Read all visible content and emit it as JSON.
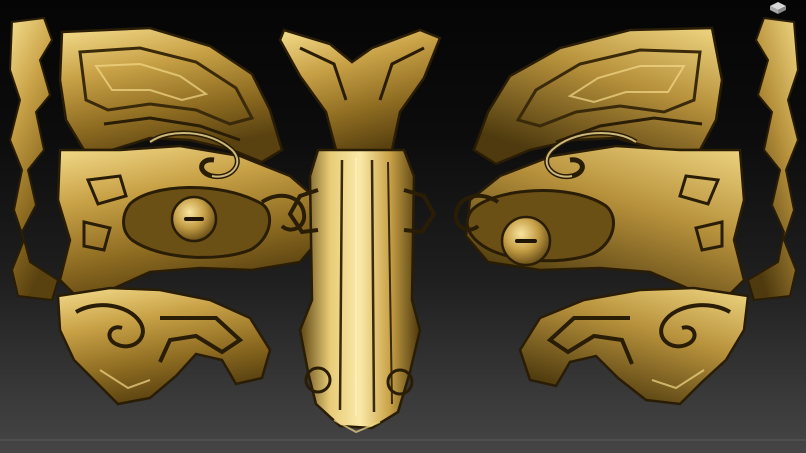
{
  "viewport": {
    "background_top": "#050505",
    "background_bottom": "#454545"
  },
  "model": {
    "subject": "bronze-taotie-mask",
    "material_colors": {
      "highlight": "#f4dc8c",
      "mid": "#b08a35",
      "shadow": "#3a2a0a",
      "deep": "#1e1404"
    }
  },
  "gizmo": {
    "icon": "navigation-cube-icon",
    "color": "#d8d8d8"
  }
}
